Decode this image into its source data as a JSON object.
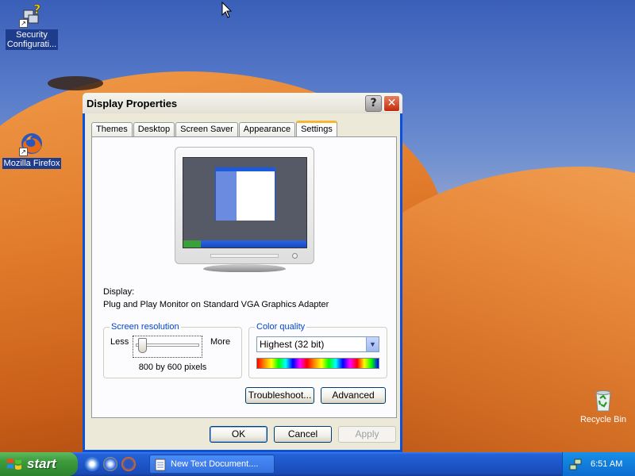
{
  "desktop": {
    "icons": [
      {
        "name": "Security Configurati...",
        "label_line1": "Security",
        "label_line2": "Configurati..."
      },
      {
        "name": "Mozilla Firefox",
        "label_line1": "Mozilla Firefox"
      },
      {
        "name": "Recycle Bin",
        "label_line1": "Recycle Bin"
      }
    ]
  },
  "dialog": {
    "title": "Display Properties",
    "help_glyph": "?",
    "close_glyph": "✕",
    "tabs": [
      "Themes",
      "Desktop",
      "Screen Saver",
      "Appearance",
      "Settings"
    ],
    "active_tab": "Settings",
    "display_label": "Display:",
    "display_value": "Plug and Play Monitor on Standard VGA Graphics Adapter",
    "resolution": {
      "legend": "Screen resolution",
      "less": "Less",
      "more": "More",
      "value_text": "800 by 600 pixels",
      "slider_level": 0
    },
    "color_quality": {
      "legend": "Color quality",
      "selected": "Highest (32 bit)"
    },
    "buttons": {
      "troubleshoot": "Troubleshoot...",
      "advanced": "Advanced",
      "ok": "OK",
      "cancel": "Cancel",
      "apply": "Apply"
    }
  },
  "taskbar": {
    "start": "start",
    "task_item": "New Text Document....",
    "clock": "6:51 AM"
  },
  "colors": {
    "title_bar_blue": "#0a50d8",
    "dialog_face": "#ece9d8",
    "start_green": "#3c9a3c",
    "taskbar_blue": "#1e56c8",
    "group_label_blue": "#0046d5"
  }
}
